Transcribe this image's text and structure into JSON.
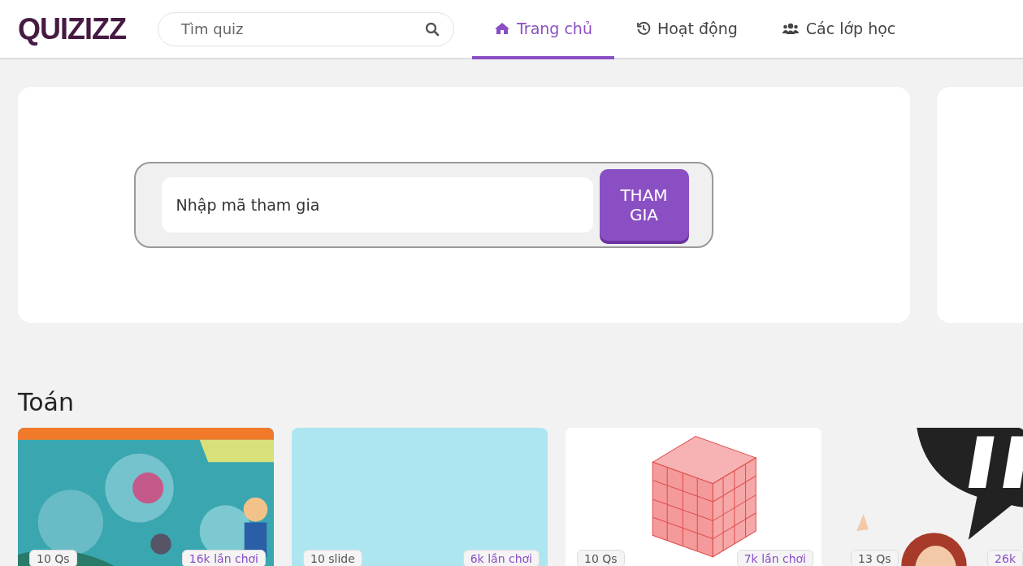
{
  "header": {
    "logo": "QUIZIZZ",
    "search": {
      "placeholder": "Tìm quiz"
    },
    "tabs": [
      {
        "label": "Trang chủ",
        "kind": "home",
        "selected": true
      },
      {
        "label": "Hoạt động",
        "kind": "history",
        "selected": false
      },
      {
        "label": "Các lớp học",
        "kind": "users",
        "selected": false
      }
    ]
  },
  "join": {
    "placeholder": "Nhập mã tham gia",
    "button": "THAM\nGIA"
  },
  "section": {
    "title": "Toán",
    "cards": [
      {
        "kind": "bubbles",
        "left": "10 Qs",
        "right": "16k lần chơi"
      },
      {
        "kind": "plain",
        "left": "10 slide",
        "right": "6k lần chơi"
      },
      {
        "kind": "cube",
        "left": "10 Qs",
        "right": "7k lần chơi"
      },
      {
        "kind": "speech",
        "left": "13 Qs",
        "right": "26k"
      }
    ]
  }
}
